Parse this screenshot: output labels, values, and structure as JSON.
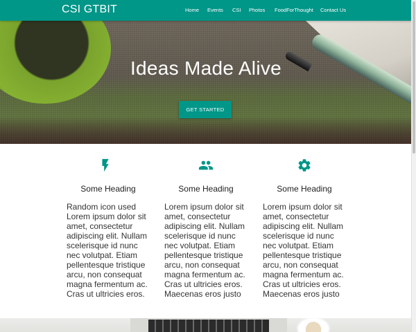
{
  "navbar": {
    "brand": "CSI GTBIT",
    "links": [
      "Home",
      "Events",
      "CSI",
      "Photos",
      "FoodForThought",
      "Contact Us"
    ]
  },
  "hero": {
    "title": "Ideas Made Alive",
    "cta_label": "GET STARTED"
  },
  "features": [
    {
      "icon": "flash-icon",
      "heading": "Some Heading",
      "body": "Random icon used Lorem ipsum dolor sit amet, consectetur adipiscing elit. Nullam scelerisque id nunc nec volutpat. Etiam pellentesque tristique arcu, non consequat magna fermentum ac. Cras ut ultricies eros."
    },
    {
      "icon": "group-icon",
      "heading": "Some Heading",
      "body": "Lorem ipsum dolor sit amet, consectetur adipiscing elit. Nullam scelerisque id nunc nec volutpat. Etiam pellentesque tristique arcu, non consequat magna fermentum ac. Cras ut ultricies eros. Maecenas eros justo"
    },
    {
      "icon": "gear-icon",
      "heading": "Some Heading",
      "body": "Lorem ipsum dolor sit amet, consectetur adipiscing elit. Nullam scelerisque id nunc nec volutpat. Etiam pellentesque tristique arcu, non consequat magna fermentum ac. Cras ut ultricies eros. Maecenas eros justo"
    }
  ],
  "colors": {
    "accent": "#009688",
    "text": "#333333"
  }
}
